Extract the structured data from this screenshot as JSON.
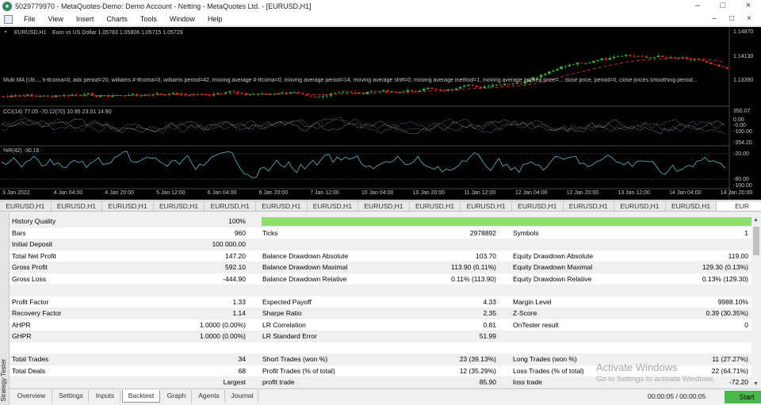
{
  "window": {
    "title": "5029779970 - MetaQuotes-Demo: Demo Account - Netting - MetaQuotes Ltd. - [EURUSD,H1]",
    "controls": [
      "–",
      "□",
      "×"
    ]
  },
  "menu": {
    "items": [
      "File",
      "View",
      "Insert",
      "Charts",
      "Tools",
      "Window",
      "Help"
    ],
    "mdi_controls": [
      "–",
      "□",
      "×"
    ]
  },
  "chart": {
    "header": "EURUSD,H1",
    "header_desc": "Euro vs US Dollar 1.05783 1.05806 1.05715 1.05729",
    "indicator_text": "Multi MA (Ult..., fi-tfcoma=0, adx period=20, williams #-tfcoma=0, williams period=42, moving average #-tfcoma=0, moving average period=14, moving average shift=0, moving average method=1, moving average applied price=... close price, period=0, close prices smoothing period...",
    "cci_label": "CCI(14) 77.05 -70.12(70) 10.95 23.51 14.90",
    "wpr_label": "%R(42) -30.16",
    "price_labels": [
      "1.14870",
      "1.14130",
      "1.13390"
    ],
    "cci_scale": [
      "350.07",
      "0.00",
      "-0.00",
      "-100.00",
      "-354.20"
    ],
    "wpr_scale": [
      "-20.00",
      "-80.00",
      "-100.00"
    ],
    "time_labels": [
      "3 Jan 2022",
      "4 Jan 04:00",
      "4 Jan 20:00",
      "5 Jan 12:00",
      "6 Jan 04:00",
      "6 Jan 20:00",
      "7 Jan 12:00",
      "10 Jan 04:00",
      "10 Jan 20:00",
      "11 Jan 12:00",
      "12 Jan 04:00",
      "12 Jan 20:00",
      "13 Jan 12:00",
      "14 Jan 04:00",
      "14 Jan 20:00"
    ],
    "colors": {
      "bull": "#3cb43c",
      "bear": "#d22828",
      "ma": "#c03030",
      "indicator": "#5fb8c8"
    }
  },
  "chart_tabs": {
    "items": [
      "EURUSD,H1",
      "EURUSD,H1",
      "EURUSD,H1",
      "EURUSD,H1",
      "EURUSD,H1",
      "EURUSD,H1",
      "EURUSD,H1",
      "EURUSD,H1",
      "EURUSD,H1",
      "EURUSD,H1",
      "EURUSD,H1",
      "EURUSD,H1",
      "EURUSD,H1",
      "EURUSD,H1",
      "EUR"
    ]
  },
  "strategy_tester": {
    "side_label": "Strategy Tester",
    "quality_label": "History Quality",
    "quality_value": "100%",
    "quality_fraction": 1.0,
    "rows": [
      {
        "c1l": "Bars",
        "c1v": "960",
        "c2l": "Ticks",
        "c2v": "2978892",
        "c3l": "Symbols",
        "c3v": "1"
      },
      {
        "c1l": "Initial Deposit",
        "c1v": "100 000.00",
        "c2l": "",
        "c2v": "",
        "c3l": "",
        "c3v": ""
      },
      {
        "c1l": "Total Net Profit",
        "c1v": "147.20",
        "c2l": "Balance Drawdown Absolute",
        "c2v": "103.70",
        "c3l": "Equity Drawdown Absolute",
        "c3v": "119.00"
      },
      {
        "c1l": "Gross Profit",
        "c1v": "592.10",
        "c2l": "Balance Drawdown Maximal",
        "c2v": "113.90 (0.11%)",
        "c3l": "Equity Drawdown Maximal",
        "c3v": "129.30 (0.13%)"
      },
      {
        "c1l": "Gross Loss",
        "c1v": "-444.90",
        "c2l": "Balance Drawdown Relative",
        "c2v": "0.11% (113.90)",
        "c3l": "Equity Drawdown Relative",
        "c3v": "0.13% (129.30)"
      },
      {
        "c1l": "",
        "c1v": "",
        "c2l": "",
        "c2v": "",
        "c3l": "",
        "c3v": ""
      },
      {
        "c1l": "Profit Factor",
        "c1v": "1.33",
        "c2l": "Expected Payoff",
        "c2v": "4.33",
        "c3l": "Margin Level",
        "c3v": "9988.10%"
      },
      {
        "c1l": "Recovery Factor",
        "c1v": "1.14",
        "c2l": "Sharpe Ratio",
        "c2v": "2.35",
        "c3l": "Z-Score",
        "c3v": "0.39 (30.35%)"
      },
      {
        "c1l": "AHPR",
        "c1v": "1.0000 (0.00%)",
        "c2l": "LR Correlation",
        "c2v": "0.81",
        "c3l": "OnTester result",
        "c3v": "0"
      },
      {
        "c1l": "GHPR",
        "c1v": "1.0000 (0.00%)",
        "c2l": "LR Standard Error",
        "c2v": "51.99",
        "c3l": "",
        "c3v": ""
      },
      {
        "c1l": "",
        "c1v": "",
        "c2l": "",
        "c2v": "",
        "c3l": "",
        "c3v": ""
      },
      {
        "c1l": "Total Trades",
        "c1v": "34",
        "c2l": "Short Trades (won %)",
        "c2v": "23 (39.13%)",
        "c3l": "Long Trades (won %)",
        "c3v": "11 (27.27%)"
      },
      {
        "c1l": "Total Deals",
        "c1v": "68",
        "c2l": "Profit Trades (% of total)",
        "c2v": "12 (35.29%)",
        "c3l": "Loss Trades (% of total)",
        "c3v": "22 (64.71%)"
      },
      {
        "c1l": "",
        "c1v": "Largest",
        "c2l": "profit trade",
        "c2v": "85.90",
        "c3l": "loss trade",
        "c3v": "-72.20"
      }
    ]
  },
  "bottom_tabs": [
    "Overview",
    "Settings",
    "Inputs",
    "Backtest",
    "Graph",
    "Agents",
    "Journal"
  ],
  "active_bottom_tab": "Backtest",
  "timer": "00:00:05 / 00:00:05",
  "start_label": "Start",
  "watermark": {
    "line1": "Activate Windows",
    "line2": "Go to Settings to activate Windows."
  }
}
